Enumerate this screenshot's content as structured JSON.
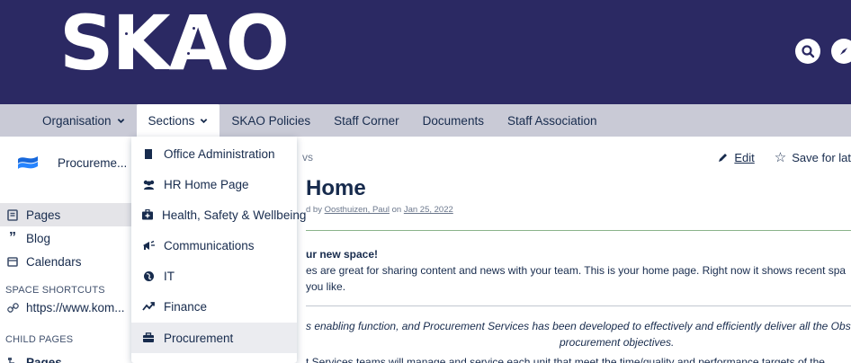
{
  "banner": {
    "logo_text": [
      "S",
      "K",
      "A",
      "O"
    ],
    "bg_color": "#2b2963",
    "icons": [
      "search-icon",
      "compass-icon"
    ]
  },
  "nav": {
    "items": [
      {
        "label": "Organisation",
        "has_menu": true
      },
      {
        "label": "Sections",
        "has_menu": true
      },
      {
        "label": "SKAO Policies",
        "has_menu": false
      },
      {
        "label": "Staff Corner",
        "has_menu": false
      },
      {
        "label": "Documents",
        "has_menu": false
      },
      {
        "label": "Staff Association",
        "has_menu": false
      }
    ],
    "chevron": "⌄"
  },
  "sidebar": {
    "space_name": "Procureme...",
    "star": "☆",
    "items": [
      {
        "label": "Pages",
        "icon": "pages-icon"
      },
      {
        "label": "Blog",
        "icon": "quote-icon"
      },
      {
        "label": "Calendars",
        "icon": "calendar-icon"
      }
    ],
    "shortcuts_heading": "SPACE SHORTCUTS",
    "shortcut": "https://www.kom...",
    "child_heading": "CHILD PAGES",
    "child_item": "Pages"
  },
  "dropdown": {
    "items": [
      {
        "label": "Office Administration",
        "icon": "document-icon"
      },
      {
        "label": "HR Home Page",
        "icon": "users-icon"
      },
      {
        "label": "Health, Safety & Wellbeing",
        "icon": "first-aid-icon"
      },
      {
        "label": "Communications",
        "icon": "megaphone-icon"
      },
      {
        "label": "IT",
        "icon": "globe-icon"
      },
      {
        "label": "Finance",
        "icon": "trend-icon"
      },
      {
        "label": "Procurement",
        "icon": "briefcase-icon"
      }
    ]
  },
  "main": {
    "breadcrumb": "vs",
    "edit_label": "Edit",
    "save_label": "Save for lat",
    "title": "Home",
    "byline_prefix": "d by",
    "byline_author": "Oosthuizen, Paul",
    "byline_on": "on",
    "byline_date": "Jan 25, 2022",
    "welcome": "ur new space!",
    "para1": "es are great for sharing content and news with your team. This is your home page. Right now it shows recent spa",
    "para2": "you like.",
    "italic1": "s enabling function, and Procurement Services has been developed to effectively and efficiently deliver all the Obser",
    "italic2": "procurement objectives.",
    "cutline": "t Services teams will manage and service each unit  that meet the time/quality and performance targets of the"
  }
}
